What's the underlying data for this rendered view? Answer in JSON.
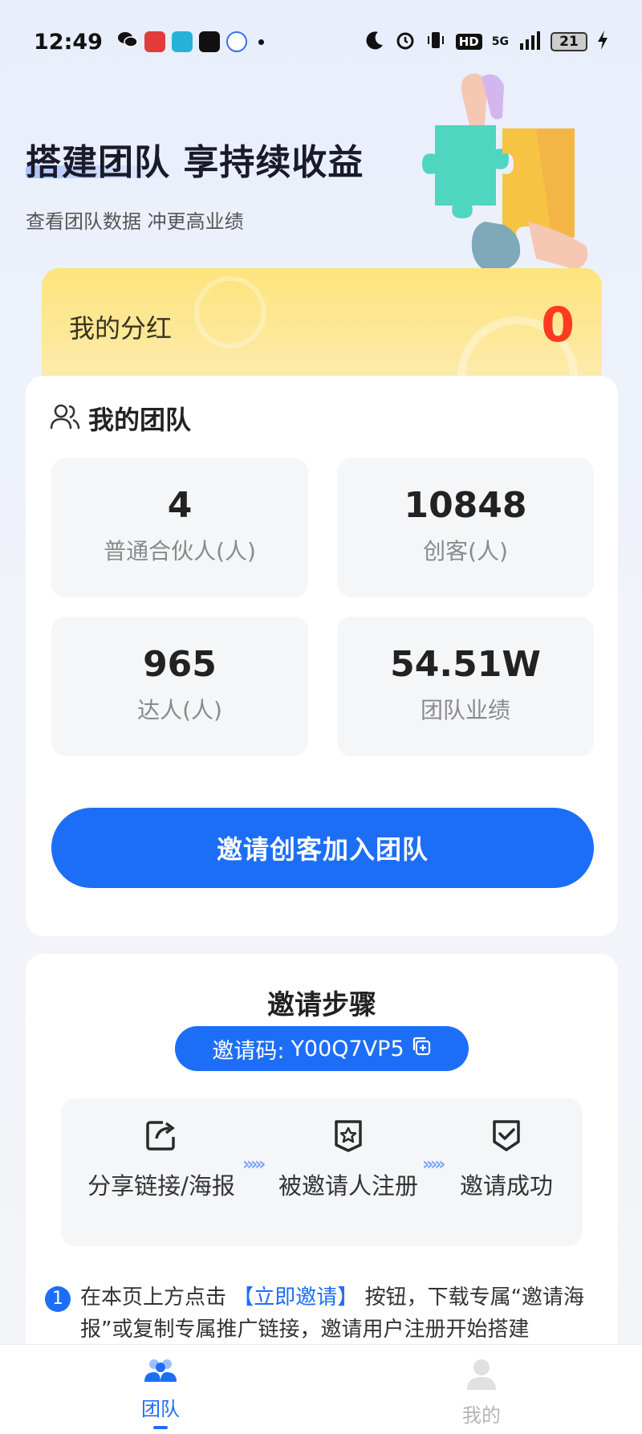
{
  "status_bar": {
    "time": "12:49",
    "hd_label": "HD",
    "network": "5G",
    "battery": "21"
  },
  "hero": {
    "title": "搭建团队 享持续收益",
    "subtitle": "查看团队数据 冲更高业绩"
  },
  "dividend": {
    "label": "我的分红",
    "value": "0"
  },
  "team": {
    "title": "我的团队",
    "stats": [
      {
        "value": "4",
        "label": "普通合伙人(人)"
      },
      {
        "value": "10848",
        "label": "创客(人)"
      },
      {
        "value": "965",
        "label": "达人(人)"
      },
      {
        "value": "54.51W",
        "label": "团队业绩"
      }
    ],
    "invite_button": "邀请创客加入团队"
  },
  "steps": {
    "title": "邀请步骤",
    "invite_code_label": "邀请码:",
    "invite_code": "Y00Q7VP5",
    "items": [
      {
        "label": "分享链接/海报",
        "icon": "share-icon"
      },
      {
        "label": "被邀请人注册",
        "icon": "star-badge-icon"
      },
      {
        "label": "邀请成功",
        "icon": "check-shield-icon"
      }
    ],
    "note_number": "1",
    "note_prefix": "在本页上方点击",
    "note_link": "【立即邀请】",
    "note_suffix": "按钮，下载专属“邀请海报”或复制专属推广链接，邀请用户注册开始搭建"
  },
  "bottom_nav": {
    "items": [
      {
        "label": "团队",
        "active": true
      },
      {
        "label": "我的",
        "active": false
      }
    ]
  },
  "colors": {
    "primary": "#1d6ef7",
    "dividend_value": "#ff3b1f",
    "dividend_bg": "#fde47c"
  }
}
